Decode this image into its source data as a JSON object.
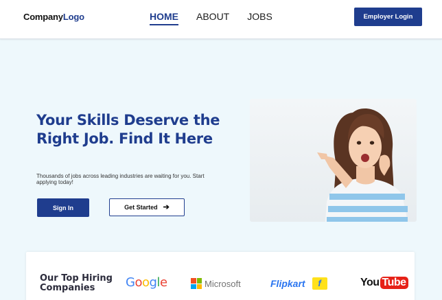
{
  "header": {
    "logo": {
      "part1": "Company",
      "part2": "Logo"
    },
    "nav": [
      {
        "label": "HOME",
        "active": true
      },
      {
        "label": "ABOUT",
        "active": false
      },
      {
        "label": "JOBS",
        "active": false
      }
    ],
    "employer_login_label": "Employer Login"
  },
  "hero": {
    "title": "Your Skills Deserve the Right Job. Find It Here",
    "subtitle": "Thousands of jobs across leading industries are waiting for you. Start applying today!",
    "signin_label": "Sign In",
    "get_started_label": "Get Started",
    "image_icon": "smiling-woman-pointing-image"
  },
  "companies": {
    "heading": "Our Top Hiring Companies",
    "logos": [
      {
        "name": "Google",
        "icon": "google-logo"
      },
      {
        "name": "Microsoft",
        "icon": "microsoft-logo"
      },
      {
        "name": "Flipkart",
        "icon": "flipkart-logo"
      },
      {
        "name": "YouTube",
        "icon": "youtube-logo",
        "part1": "You",
        "part2": "Tube"
      }
    ]
  },
  "colors": {
    "brand": "#1f3d8e",
    "background": "#eef8fc",
    "google_blue": "#4285f4",
    "google_red": "#ea4335",
    "google_yellow": "#fbbc05",
    "google_green": "#34a853",
    "microsoft_red": "#f25022",
    "microsoft_green": "#7fba00",
    "microsoft_blue": "#00a4ef",
    "microsoft_yellow": "#ffb900",
    "flipkart_blue": "#2874f0",
    "flipkart_yellow": "#ffe11b",
    "youtube_red": "#e62117"
  }
}
